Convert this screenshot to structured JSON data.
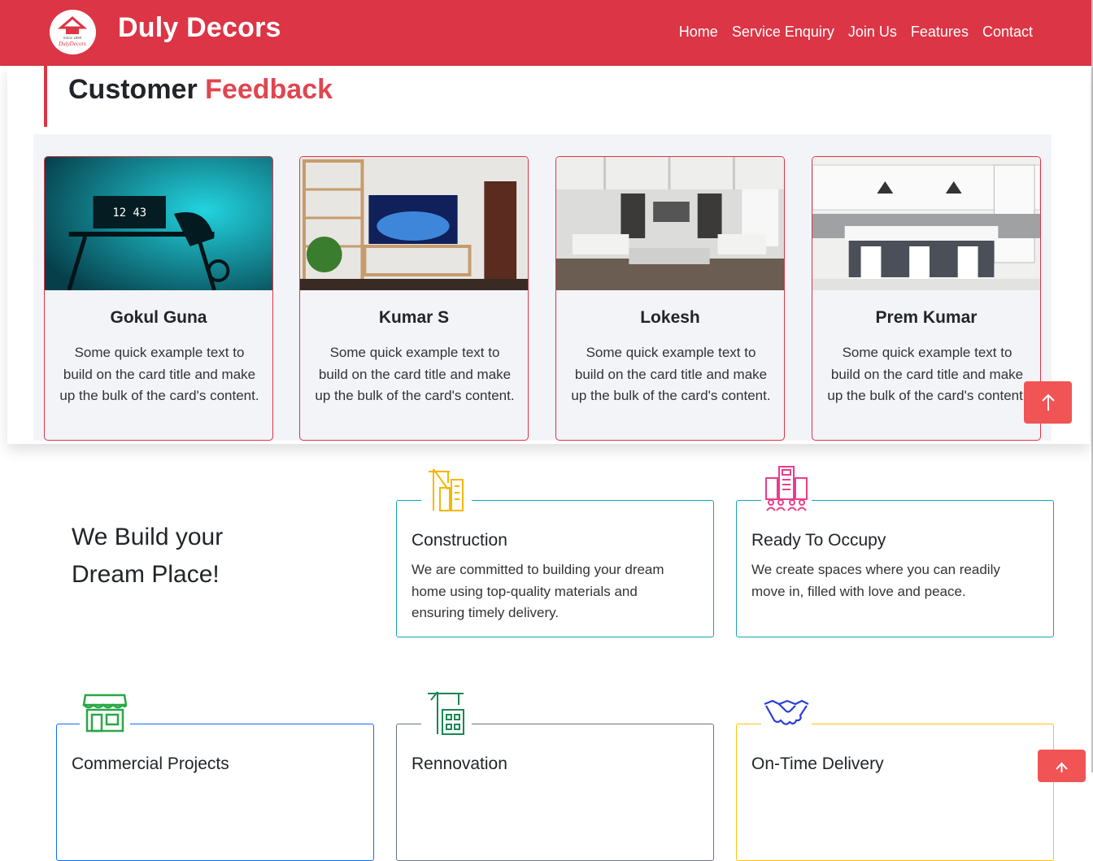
{
  "navbar": {
    "brand": "Duly Decors",
    "logo_text_top": "Since 1980",
    "logo_text_bottom": "DulyDecors",
    "links": [
      "Home",
      "Service Enquiry",
      "Join Us",
      "Features",
      "Contact"
    ]
  },
  "feedback": {
    "title_main": "Customer",
    "title_accent": "Feedback",
    "cards": [
      {
        "name": "Gokul Guna",
        "text": "Some quick example text to build on the card title and make up the bulk of the card's content.",
        "image": "neon-desk-room"
      },
      {
        "name": "Kumar S",
        "text": "Some quick example text to build on the card title and make up the bulk of the card's content.",
        "image": "tv-living-room"
      },
      {
        "name": "Lokesh",
        "text": "Some quick example text to build on the card title and make up the bulk of the card's content.",
        "image": "white-living-room"
      },
      {
        "name": "Prem Kumar",
        "text": "Some quick example text to build on the card title and make up the bulk of the card's content.",
        "image": "kitchen-island"
      }
    ]
  },
  "services": {
    "headline": "We Build your Dream Place!",
    "items": [
      {
        "title": "Construction",
        "desc": "We are committed to building your dream home using top-quality materials and ensuring timely delivery.",
        "icon": "crane-building-icon",
        "border": "#17a2b8",
        "icon_color": "#f5b700"
      },
      {
        "title": "Ready To Occupy",
        "desc": "We create spaces where you can readily move in, filled with love and peace.",
        "icon": "city-building-icon",
        "border": "#17a2b8",
        "icon_color": "#e83e8c"
      },
      {
        "title": "Commercial Projects",
        "desc": "",
        "icon": "storefront-icon",
        "border": "#0d6efd",
        "icon_color": "#28a745"
      },
      {
        "title": "Rennovation",
        "desc": "",
        "icon": "renovation-crane-icon",
        "border": "#6c757d",
        "icon_color": "#198754"
      },
      {
        "title": "On-Time Delivery",
        "desc": "",
        "icon": "handshake-icon",
        "border": "#ffc107",
        "icon_color": "#2b3ed8"
      }
    ]
  },
  "colors": {
    "primary": "#dc3545",
    "accent": "#e04650",
    "scroll_top": "#f05454"
  }
}
